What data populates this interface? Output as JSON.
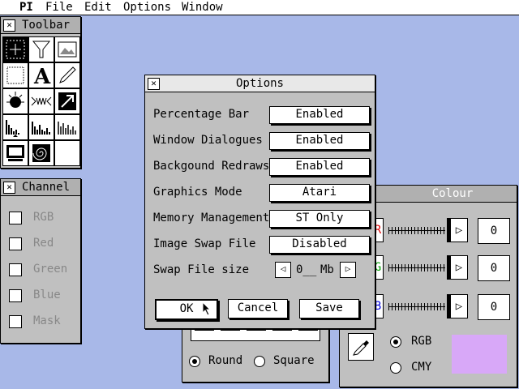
{
  "menubar": {
    "items": [
      "PI",
      "File",
      "Edit",
      "Options",
      "Window"
    ]
  },
  "toolbar": {
    "title": "Toolbar"
  },
  "channel": {
    "title": "Channel",
    "items": [
      "RGB",
      "Red",
      "Green",
      "Blue",
      "Mask"
    ]
  },
  "colour": {
    "title": "Colour",
    "sliders": [
      {
        "label": "R",
        "value": "0",
        "color": "#e00000"
      },
      {
        "label": "G",
        "value": "0",
        "color": "#00a000"
      },
      {
        "label": "B",
        "value": "0",
        "color": "#0000e0"
      }
    ],
    "modes": [
      "RGB",
      "CMY"
    ],
    "selected_mode": "RGB",
    "swatch_color": "#d8a8f8"
  },
  "brush": {
    "shapes": [
      "Round",
      "Square"
    ],
    "selected_shape": "Round"
  },
  "options": {
    "title": "Options",
    "rows": [
      {
        "label": "Percentage Bar",
        "value": "Enabled"
      },
      {
        "label": "Window Dialogues",
        "value": "Enabled"
      },
      {
        "label": "Backgound Redraws",
        "value": "Enabled"
      },
      {
        "label": "Graphics Mode",
        "value": "Atari"
      },
      {
        "label": "Memory Management",
        "value": "ST Only"
      },
      {
        "label": "Image Swap File",
        "value": "Disabled"
      }
    ],
    "swap_size": {
      "label": "Swap File size",
      "value": "0__",
      "unit": "Mb"
    },
    "buttons": {
      "ok": "OK",
      "cancel": "Cancel",
      "save": "Save"
    }
  }
}
